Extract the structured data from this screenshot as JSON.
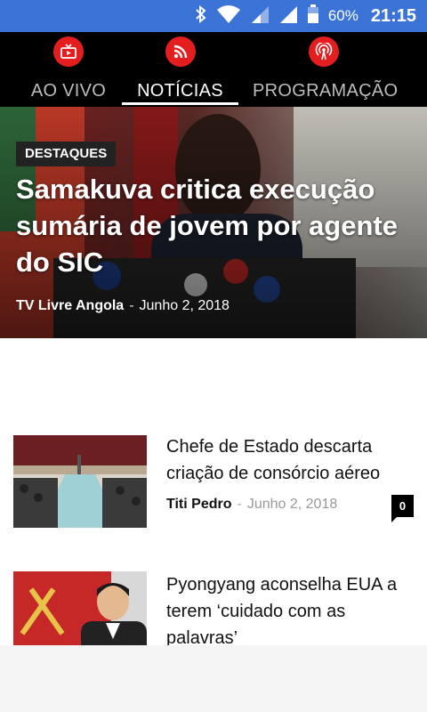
{
  "status_bar": {
    "battery_percent": "60%",
    "time": "21:15",
    "icons": [
      "bluetooth-icon",
      "wifi-icon",
      "signal-icon",
      "signal-icon",
      "battery-icon"
    ]
  },
  "tabs": [
    {
      "label": "AO VIVO",
      "icon": "tv-icon",
      "active": false
    },
    {
      "label": "NOTÍCIAS",
      "icon": "rss-icon",
      "active": true
    },
    {
      "label": "PROGRAMAÇÃO",
      "icon": "radio-tower-icon",
      "active": false
    }
  ],
  "featured": {
    "category": "DESTAQUES",
    "title": "Samakuva critica execução sumária de jovem por agente do SIC",
    "author": "TV Livre Angola",
    "separator": "-",
    "date": "Junho 2, 2018"
  },
  "articles": [
    {
      "title": "Chefe de Estado descarta criação de consórcio aéreo",
      "author": "Titi Pedro",
      "separator": "-",
      "date": "Junho 2, 2018",
      "comments": "0"
    },
    {
      "title": "Pyongyang aconselha EUA a terem ‘cuidado com as palavras’"
    }
  ]
}
